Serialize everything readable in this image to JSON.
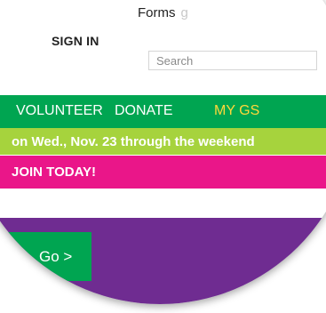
{
  "header": {
    "forms_link": "Forms",
    "forms_tail": "g",
    "signin": "SIGN IN",
    "search_placeholder": "Search"
  },
  "nav": {
    "items": [
      {
        "label": "VOLUNTEER"
      },
      {
        "label": "DONATE"
      },
      {
        "label": "MY GS"
      }
    ]
  },
  "banners": {
    "lime": "on Wed., Nov. 23 through the weekend",
    "pink": "JOIN TODAY!"
  },
  "cta": {
    "go_label": "Go >"
  },
  "colors": {
    "green": "#00a551",
    "lime": "#a6d33d",
    "pink": "#ea1689",
    "purple": "#6f2c91",
    "gold": "#ffd83a"
  }
}
